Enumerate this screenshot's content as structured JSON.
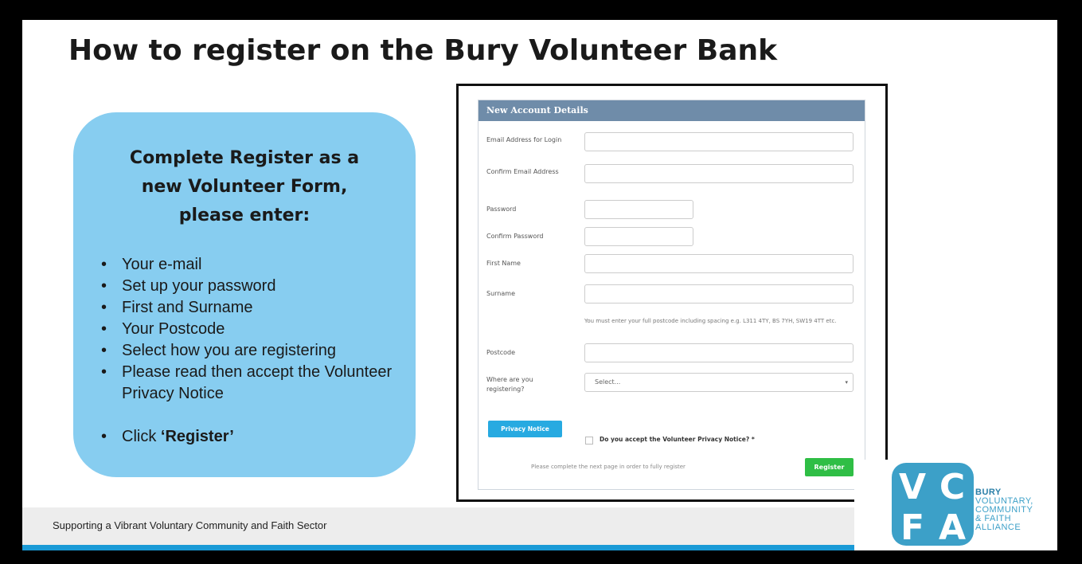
{
  "slide": {
    "title": "How to register on the Bury Volunteer Bank"
  },
  "instructions": {
    "heading_lines": [
      "Complete Register as a",
      "new Volunteer Form,",
      "please enter:"
    ],
    "steps": [
      "Your e-mail",
      "Set up your password",
      "First and Surname",
      "Your Postcode",
      "Select how you are registering",
      "Please read then accept the Volunteer Privacy Notice"
    ],
    "final_step_prefix": "Click ",
    "final_step_bold": "‘Register’"
  },
  "form": {
    "header": "New Account Details",
    "fields": {
      "email": "Email Address for Login",
      "confirm_email": "Confirm Email Address",
      "password": "Password",
      "confirm_password": "Confirm Password",
      "first_name": "First Name",
      "surname": "Surname",
      "postcode": "Postcode",
      "registering": "Where are you registering?"
    },
    "postcode_hint": "You must enter your full postcode including spacing e.g. L311 4TY, BS 7YH, SW19 4TT etc.",
    "select_placeholder": "Select...",
    "privacy_button": "Privacy Notice",
    "accept_label": "Do you accept the Volunteer Privacy Notice? *",
    "footnote": "Please complete the next page in order to fully register",
    "register_button": "Register"
  },
  "footer": {
    "tagline": "Supporting a Vibrant Voluntary Community and Faith Sector"
  },
  "logo": {
    "mark_letters": [
      "V",
      "C",
      "F",
      "A"
    ],
    "text_lines": [
      "BURY",
      "VOLUNTARY,",
      "COMMUNITY",
      "& FAITH",
      "ALLIANCE"
    ]
  },
  "colors": {
    "bubble": "#87cdf0",
    "form_header": "#6f8ca9",
    "privacy_button": "#27aae1",
    "register_button": "#2fbe45",
    "footer_bar": "#1a9ad6",
    "logo_blue": "#3ca0c8"
  }
}
